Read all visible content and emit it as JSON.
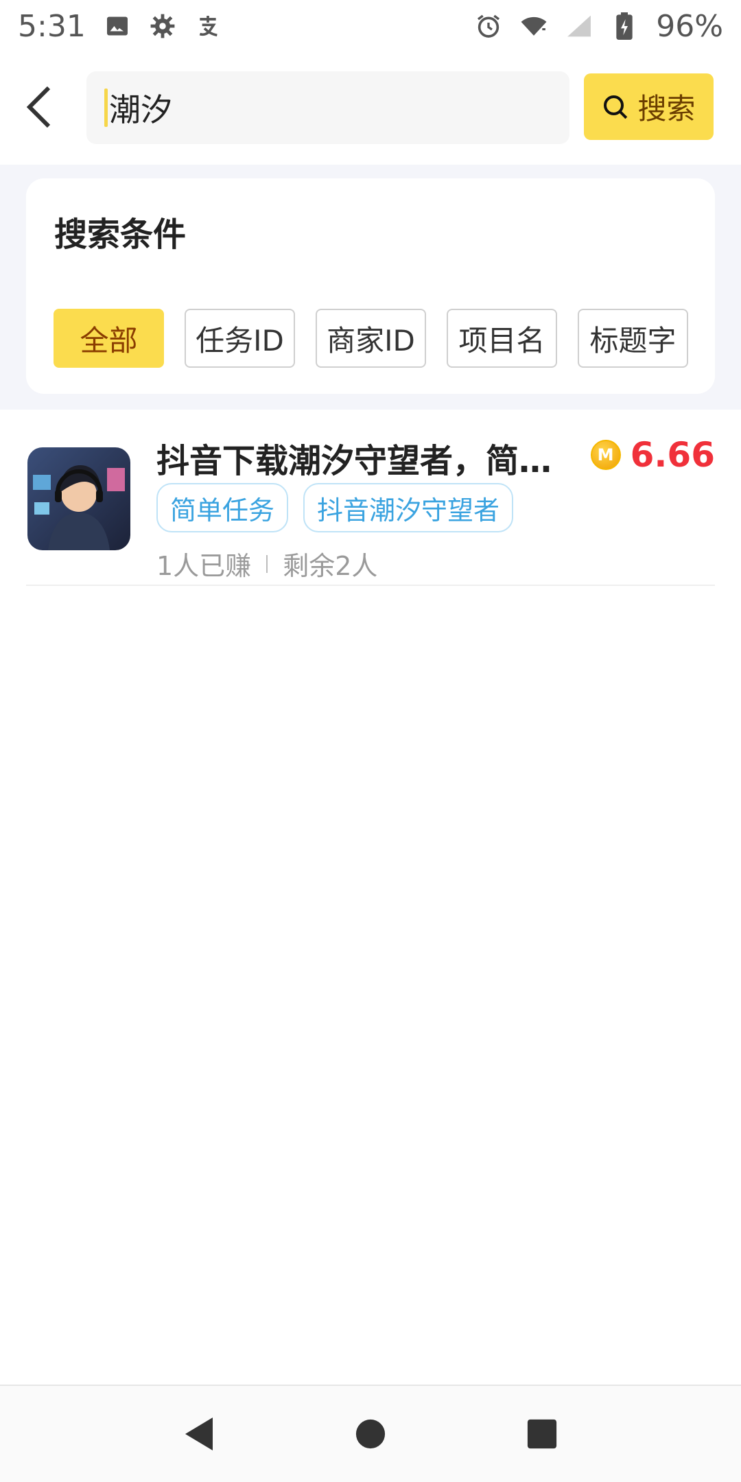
{
  "status_bar": {
    "time": "5:31",
    "battery_percent": "96%",
    "icons_left": [
      "image-icon",
      "gear-icon",
      "alipay-icon"
    ],
    "icons_right": [
      "alarm-icon",
      "wifi-icon",
      "signal-icon",
      "battery-charging-icon"
    ]
  },
  "header": {
    "search_value": "潮汐",
    "search_button_label": "搜索"
  },
  "filters": {
    "title": "搜索条件",
    "chips": [
      {
        "label": "全部",
        "active": true
      },
      {
        "label": "任务ID",
        "active": false
      },
      {
        "label": "商家ID",
        "active": false
      },
      {
        "label": "项目名",
        "active": false
      },
      {
        "label": "标题字",
        "active": false
      }
    ]
  },
  "results": [
    {
      "title": "抖音下载潮汐守望者，简单任务",
      "reward": "6.66",
      "coin_letter": "M",
      "tags": [
        "简单任务",
        "抖音潮汐守望者"
      ],
      "earned": "1人已赚",
      "remaining": "剩余2人"
    }
  ],
  "colors": {
    "accent_yellow": "#fbdc4e",
    "reward_red": "#f0303a",
    "tag_blue": "#3aa3e0"
  },
  "navbar": {
    "icons": [
      "back-triangle-icon",
      "home-circle-icon",
      "recents-square-icon"
    ]
  }
}
